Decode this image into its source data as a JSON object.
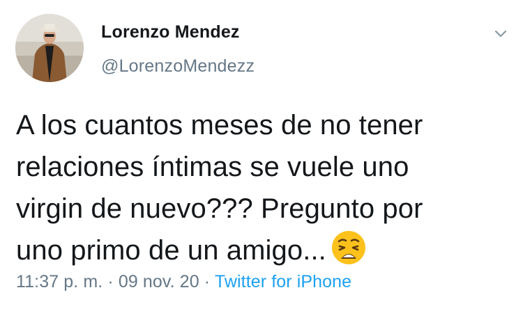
{
  "user": {
    "display_name": "Lorenzo Mendez",
    "handle": "@LorenzoMendezz"
  },
  "tweet": {
    "line1": "A los cuantos meses de no tener",
    "line2": "relaciones íntimas se vuele uno",
    "line3": "virgin de nuevo??? Pregunto por",
    "line4": "uno primo de un amigo...",
    "emoji": "weary-face"
  },
  "meta": {
    "time": "11:37 p. m.",
    "sep1": " · ",
    "date": "09 nov. 20",
    "sep2": " · ",
    "source": "Twitter for iPhone"
  },
  "colors": {
    "text": "#14171a",
    "secondary": "#657786",
    "link": "#1da1f2"
  },
  "icons": [
    "chevron-down-icon",
    "weary-face-emoji"
  ]
}
